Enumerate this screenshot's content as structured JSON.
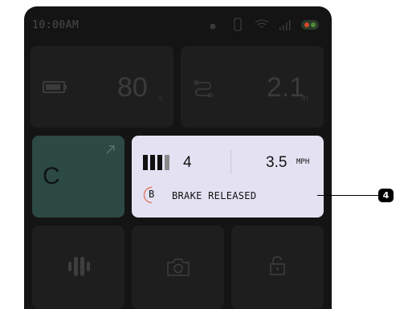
{
  "status_bar": {
    "time": "10:00AM"
  },
  "battery": {
    "value": "80",
    "unit": "%"
  },
  "trip": {
    "value": "2.1",
    "unit": "MI"
  },
  "gear": {
    "letter": "C"
  },
  "ride_status": {
    "level": "4",
    "speed": "3.5",
    "speed_unit": "MPH",
    "brake_letter": "B",
    "brake_text": "BRAKE RELEASED"
  },
  "callout": {
    "number": "4"
  },
  "icons": [
    "battery-icon",
    "route-icon",
    "expand-icon",
    "level-bars-icon",
    "brake-icon",
    "vibration-icon",
    "camera-icon",
    "unlock-icon"
  ],
  "colors": {
    "background": "#141414",
    "card": "#1e1e1e",
    "gear_card": "#2d4943",
    "status_card": "#e4e2f2",
    "brake_accent": "#e47b6b"
  }
}
